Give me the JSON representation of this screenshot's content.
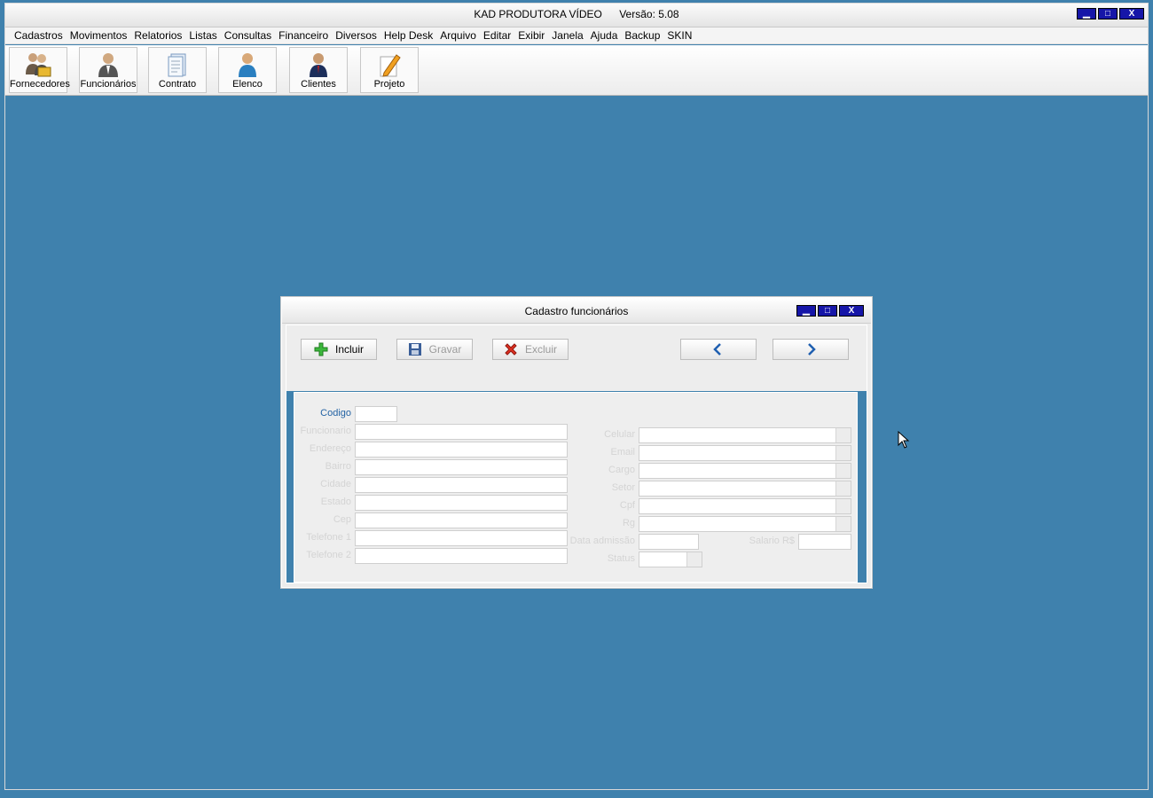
{
  "app": {
    "title": "KAD PRODUTORA VÍDEO",
    "version": "Versão: 5.08"
  },
  "window_controls": {
    "minimize": "▁",
    "maximize": "□",
    "close": "X"
  },
  "menu": [
    "Cadastros",
    "Movimentos",
    "Relatorios",
    "Listas",
    "Consultas",
    "Financeiro",
    "Diversos",
    "Help Desk",
    "Arquivo",
    "Editar",
    "Exibir",
    "Janela",
    "Ajuda",
    "Backup",
    "SKIN"
  ],
  "toolbar": [
    {
      "label": "Fornecedores",
      "icon": "suppliers-icon"
    },
    {
      "label": "Funcionários",
      "icon": "employee-icon"
    },
    {
      "label": "Contrato",
      "icon": "contract-document-icon"
    },
    {
      "label": "Elenco",
      "icon": "cast-person-icon"
    },
    {
      "label": "Clientes",
      "icon": "client-person-icon"
    },
    {
      "label": "Projeto",
      "icon": "project-pencil-icon"
    }
  ],
  "dialog": {
    "title": "Cadastro funcionários",
    "buttons": {
      "incluir": "Incluir",
      "gravar": "Gravar",
      "excluir": "Excluir"
    },
    "fields_left": {
      "codigo": "Codigo",
      "funcionario": "Funcionario",
      "endereco": "Endereço",
      "bairro": "Bairro",
      "cidade": "Cidade",
      "estado": "Estado",
      "cep": "Cep",
      "telefone1": "Telefone 1",
      "telefone2": "Telefone 2"
    },
    "fields_right": {
      "celular": "Celular",
      "email": "Email",
      "cargo": "Cargo",
      "setor": "Setor",
      "cpf": "Cpf",
      "rg": "Rg",
      "data_admissao": "Data admissão",
      "salario": "Salario R$",
      "status": "Status"
    }
  },
  "colors": {
    "desktop": "#3f81ad",
    "titlebar_buttons": "#1616a8",
    "codigo_label": "#2463a4"
  }
}
